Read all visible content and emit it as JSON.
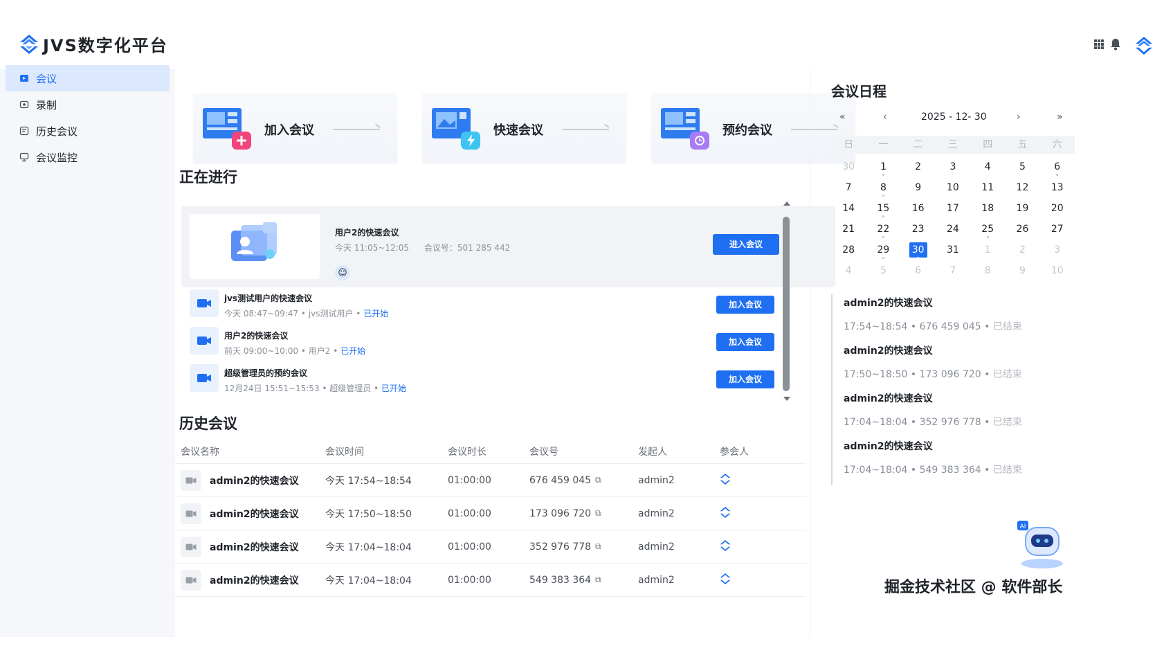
{
  "app": {
    "title": "JVS数字化平台"
  },
  "sidebar": {
    "items": [
      {
        "label": "会议",
        "icon": "video-call-icon",
        "active": true
      },
      {
        "label": "录制",
        "icon": "record-icon",
        "active": false
      },
      {
        "label": "历史会议",
        "icon": "history-icon",
        "active": false
      },
      {
        "label": "会议监控",
        "icon": "monitor-icon",
        "active": false
      }
    ]
  },
  "quick_actions": [
    {
      "label": "加入会议",
      "icon": "join-meeting-icon",
      "badge_color": "#f0457c"
    },
    {
      "label": "快速会议",
      "icon": "quick-meeting-icon",
      "badge_color": "#3ec4f0"
    },
    {
      "label": "预约会议",
      "icon": "schedule-meeting-icon",
      "badge_color": "#a77cf5"
    }
  ],
  "ongoing": {
    "title": "正在进行",
    "featured": {
      "title": "用户2的快速会议",
      "time": "今天 11:05~12:05",
      "meeting_id": "会议号：501 285 442",
      "button": "进入会议"
    },
    "items": [
      {
        "title": "jvs测试用户的快速会议",
        "time": "今天 08:47~09:47",
        "host": "jvs测试用户",
        "status": "已开始",
        "button": "加入会议"
      },
      {
        "title": "用户2的快速会议",
        "time": "前天 09:00~10:00",
        "host": "用户2",
        "status": "已开始",
        "button": "加入会议"
      },
      {
        "title": "超级管理员的预约会议",
        "time": "12月24日 15:51~15:53",
        "host": "超级管理员",
        "status": "已开始",
        "button": "加入会议"
      }
    ]
  },
  "history": {
    "title": "历史会议",
    "columns": [
      "会议名称",
      "会议时间",
      "会议时长",
      "会议号",
      "发起人",
      "参会人"
    ],
    "rows": [
      {
        "name": "admin2的快速会议",
        "time": "今天 17:54~18:54",
        "duration": "01:00:00",
        "id": "676 459 045",
        "host": "admin2"
      },
      {
        "name": "admin2的快速会议",
        "time": "今天 17:50~18:50",
        "duration": "01:00:00",
        "id": "173 096 720",
        "host": "admin2"
      },
      {
        "name": "admin2的快速会议",
        "time": "今天 17:04~18:04",
        "duration": "01:00:00",
        "id": "352 976 778",
        "host": "admin2"
      },
      {
        "name": "admin2的快速会议",
        "time": "今天 17:04~18:04",
        "duration": "01:00:00",
        "id": "549 383 364",
        "host": "admin2"
      }
    ]
  },
  "calendar": {
    "title": "会议日程",
    "current": "2025 - 12- 30",
    "nav": {
      "prev_year": "«",
      "prev_month": "‹",
      "next_month": "›",
      "next_year": "»"
    },
    "weekdays": [
      "日",
      "一",
      "二",
      "三",
      "四",
      "五",
      "六"
    ],
    "weeks": [
      [
        "30",
        "1",
        "2",
        "3",
        "4",
        "5",
        "6"
      ],
      [
        "7",
        "8",
        "9",
        "10",
        "11",
        "12",
        "13"
      ],
      [
        "14",
        "15",
        "16",
        "17",
        "18",
        "19",
        "20"
      ],
      [
        "21",
        "22",
        "23",
        "24",
        "25",
        "26",
        "27"
      ],
      [
        "28",
        "29",
        "30",
        "31",
        "1",
        "2",
        "3"
      ],
      [
        "4",
        "5",
        "6",
        "7",
        "8",
        "9",
        "10"
      ]
    ]
  },
  "schedule": [
    {
      "title": "admin2的快速会议",
      "time": "17:54~18:54",
      "id": "676 459 045",
      "status": "已结束"
    },
    {
      "title": "admin2的快速会议",
      "time": "17:50~18:50",
      "id": "173 096 720",
      "status": "已结束"
    },
    {
      "title": "admin2的快速会议",
      "time": "17:04~18:04",
      "id": "352 976 778",
      "status": "已结束"
    },
    {
      "title": "admin2的快速会议",
      "time": "17:04~18:04",
      "id": "549 383 364",
      "status": "已结束"
    }
  ],
  "watermark": "掘金技术社区 @ 软件部长",
  "colors": {
    "accent": "#1f6ff2",
    "active_bg": "#dbe8fd"
  }
}
